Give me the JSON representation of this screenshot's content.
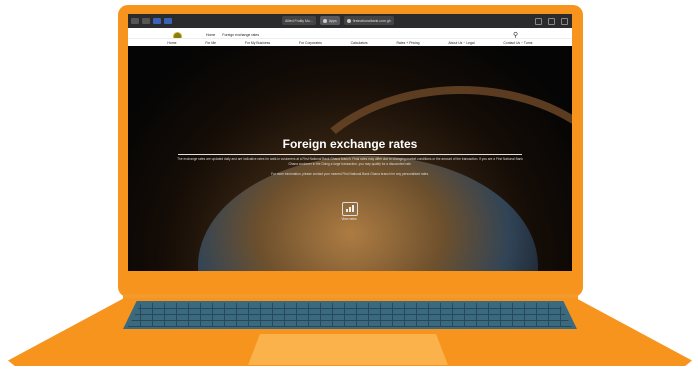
{
  "browser": {
    "tabs": [
      {
        "label": "Allied Fruitly Mu..."
      },
      {
        "label": "Apps"
      },
      {
        "label": "firstnationalbank.com.gh"
      }
    ]
  },
  "site": {
    "breadcrumb": [
      "Home",
      "Foreign exchange rates"
    ],
    "nav": [
      "Home",
      "For Me",
      "For My Business",
      "For Corporates",
      "Calculators",
      "Rates + Pricing",
      "About Us ~ Legal",
      "Contact Us ~ Turns"
    ]
  },
  "hero": {
    "title": "Foreign exchange rates",
    "body": "The exchange rates are updated daily and are indicative rates for walk-in customers at a First National Bank Ghana branch. Final rates may differ due to changing market conditions or the amount of the transaction. If you are a First National Bank Ghana customer in the Doing a large transaction, you may qualify for a discounted rate.",
    "note": "For more information, please contact your nearest First National Bank Ghana branch for any personalised rates.",
    "button_label": "View rates"
  },
  "colors": {
    "device_orange": "#f7941d",
    "keyboard_teal": "#3b6a7e"
  }
}
